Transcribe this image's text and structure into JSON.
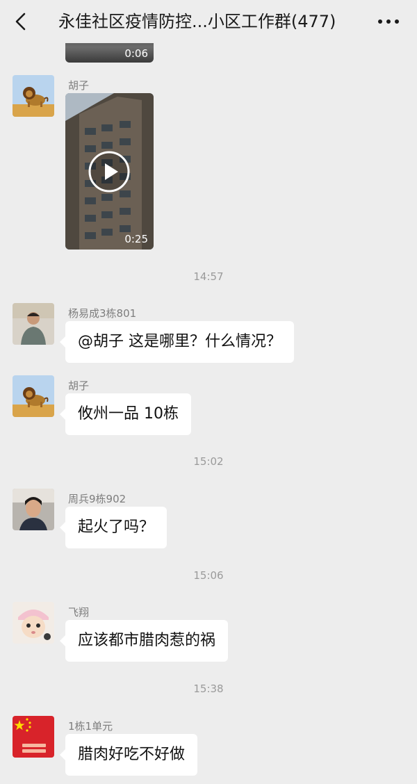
{
  "header": {
    "title": "永佳社区疫情防控...小区工作群(477)",
    "back_icon": "chevron-left-icon",
    "more_icon": "more-dots-icon"
  },
  "messages": {
    "prev_video_duration": "0:06",
    "m1": {
      "sender": "胡子",
      "video_duration": "0:25"
    },
    "t1": "14:57",
    "m2": {
      "sender": "杨易成3栋801",
      "text": "@胡子  这是哪里？什么情况？"
    },
    "m3": {
      "sender": "胡子",
      "text": "攸州一品 10栋"
    },
    "t2": "15:02",
    "m4": {
      "sender": "周兵9栋902",
      "text": "起火了吗？"
    },
    "t3": "15:06",
    "m5": {
      "sender": "飞翔",
      "text": "应该都市腊肉惹的祸"
    },
    "t4": "15:38",
    "m6": {
      "sender": "1栋1单元",
      "text": "腊肉好吃不好做"
    }
  },
  "colors": {
    "background": "#ededed",
    "bubble": "#ffffff",
    "sender_text": "#7d7d7d",
    "timestamp_text": "#9a9a9a"
  }
}
